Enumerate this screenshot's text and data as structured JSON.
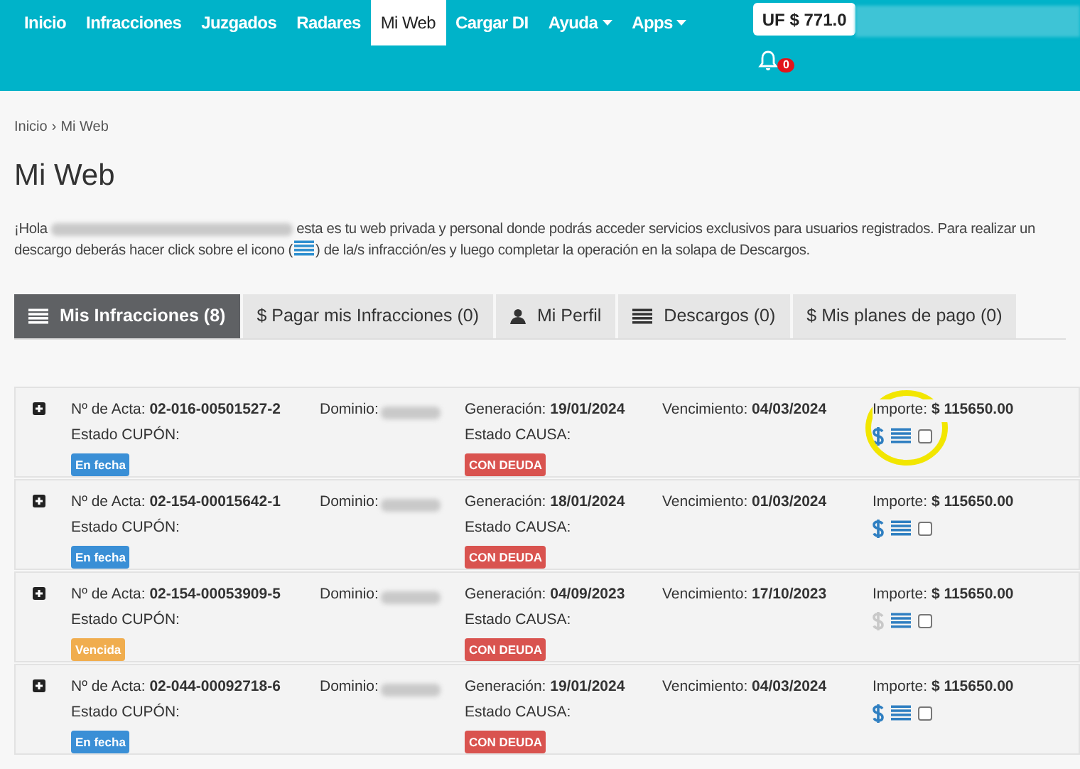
{
  "nav": {
    "items": [
      {
        "label": "Inicio",
        "selected": false,
        "dropdown": false
      },
      {
        "label": "Infracciones",
        "selected": false,
        "dropdown": false
      },
      {
        "label": "Juzgados",
        "selected": false,
        "dropdown": false
      },
      {
        "label": "Radares",
        "selected": false,
        "dropdown": false
      },
      {
        "label": "Mi Web",
        "selected": true,
        "dropdown": false
      },
      {
        "label": "Cargar DI",
        "selected": false,
        "dropdown": false
      },
      {
        "label": "Ayuda",
        "selected": false,
        "dropdown": true
      },
      {
        "label": "Apps",
        "selected": false,
        "dropdown": true
      }
    ],
    "uf": "UF $ 771.0",
    "notifications": "0"
  },
  "breadcrumb": {
    "items": [
      "Inicio",
      "Mi Web"
    ],
    "separator": "›"
  },
  "title": "Mi Web",
  "intro": {
    "greeting": "¡Hola",
    "text_before_icon": "esta es tu web privada y personal donde podrás acceder servicios exclusivos para usuarios registrados. Para realizar un descargo deberás hacer click sobre el icono (",
    "text_after_icon": ") de la/s infracción/es y luego completar la operación en la solapa de Descargos."
  },
  "tabs": [
    {
      "label": "Mis Infracciones (8)",
      "kind": "list",
      "selected": true
    },
    {
      "label": "$ Pagar mis Infracciones (0)",
      "kind": "plain",
      "selected": false
    },
    {
      "label": "Mi Perfil",
      "kind": "profile",
      "selected": false
    },
    {
      "label": "Descargos (0)",
      "kind": "list",
      "selected": false
    },
    {
      "label": "$ Mis planes de pago (0)",
      "kind": "plain",
      "selected": false
    }
  ],
  "rows": [
    {
      "acta_label": "Nº de Acta:",
      "acta": "02-016-00501527-2",
      "cupon_label": "Estado CUPÓN:",
      "cupon": "En fecha",
      "color": "#3a8fd6",
      "dominio_label": "Dominio:",
      "generacion_label": "Generación:",
      "generacion": "19/01/2024",
      "causa_label": "Estado CAUSA:",
      "causa": "CON DEUDA",
      "vencimiento_label": "Vencimiento:",
      "vencimiento": "04/03/2024",
      "importe_label": "Importe:",
      "importe": "$ 115650.00",
      "pay_enabled": true,
      "checked": false,
      "highlighted": true
    },
    {
      "acta_label": "Nº de Acta:",
      "acta": "02-154-00015642-1",
      "cupon_label": "Estado CUPÓN:",
      "cupon": "En fecha",
      "color": "#3a8fd6",
      "dominio_label": "Dominio:",
      "generacion_label": "Generación:",
      "generacion": "18/01/2024",
      "causa_label": "Estado CAUSA:",
      "causa": "CON DEUDA",
      "vencimiento_label": "Vencimiento:",
      "vencimiento": "01/03/2024",
      "importe_label": "Importe:",
      "importe": "$ 115650.00",
      "pay_enabled": true,
      "checked": false,
      "highlighted": false
    },
    {
      "acta_label": "Nº de Acta:",
      "acta": "02-154-00053909-5",
      "cupon_label": "Estado CUPÓN:",
      "cupon": "Vencida",
      "color": "#f0ad4e",
      "dominio_label": "Dominio:",
      "generacion_label": "Generación:",
      "generacion": "04/09/2023",
      "causa_label": "Estado CAUSA:",
      "causa": "CON DEUDA",
      "vencimiento_label": "Vencimiento:",
      "vencimiento": "17/10/2023",
      "importe_label": "Importe:",
      "importe": "$ 115650.00",
      "pay_enabled": false,
      "checked": false,
      "highlighted": false
    },
    {
      "acta_label": "Nº de Acta:",
      "acta": "02-044-00092718-6",
      "cupon_label": "Estado CUPÓN:",
      "cupon": "En fecha",
      "color": "#3a8fd6",
      "dominio_label": "Dominio:",
      "generacion_label": "Generación:",
      "generacion": "19/01/2024",
      "causa_label": "Estado CAUSA:",
      "causa": "CON DEUDA",
      "vencimiento_label": "Vencimiento:",
      "vencimiento": "04/03/2024",
      "importe_label": "Importe:",
      "importe": "$ 115650.00",
      "pay_enabled": true,
      "checked": false,
      "highlighted": false
    }
  ]
}
